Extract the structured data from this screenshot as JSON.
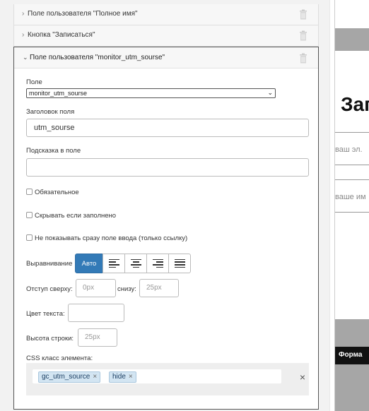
{
  "accordion": {
    "collapsed_items": [
      {
        "label": "Поле пользователя \"Полное имя\""
      },
      {
        "label": "Кнопка \"Записаться\""
      }
    ],
    "open_item": {
      "label": "Поле пользователя \"monitor_utm_sourse\""
    }
  },
  "form": {
    "field_label": "Поле",
    "field_select_value": "monitor_utm_sourse",
    "field_title_label": "Заголовок поля",
    "field_title_value": "utm_sourse",
    "hint_label": "Подсказка в поле",
    "hint_value": "",
    "required_label": "Обязательное",
    "hide_if_filled_label": "Скрывать если заполнено",
    "link_only_label": "Не показывать сразу поле ввода (только ссылку)",
    "align_label": "Выравнивание",
    "align_auto_label": "Авто",
    "margin_top_label": "Отступ сверху:",
    "margin_top_placeholder": "0px",
    "margin_bottom_label": "снизу:",
    "margin_bottom_placeholder": "25px",
    "text_color_label": "Цвет текста:",
    "line_height_label": "Высота строки:",
    "line_height_placeholder": "25px",
    "css_class_label": "CSS класс элемента:",
    "css_tags": [
      "gc_utm_source",
      "hide"
    ],
    "tag_remove_glyph": "×",
    "clear_glyph": "×"
  },
  "preview": {
    "heading": "Зап",
    "email_placeholder": "ваш эл.",
    "name_placeholder": "ваше им",
    "button_label": "Форма"
  },
  "colors": {
    "accent": "#337ab7",
    "panel_bg": "#f2f2f2",
    "tag_bg": "#d3e5f2"
  }
}
